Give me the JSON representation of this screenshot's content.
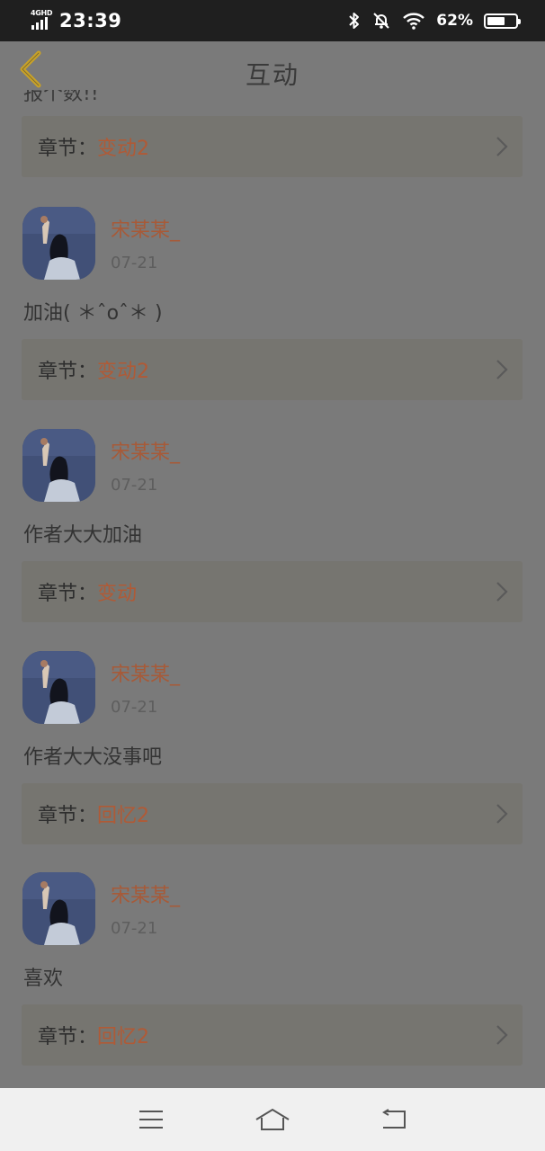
{
  "status_bar": {
    "network": "4GHD",
    "time": "23:39",
    "battery_percent": "62%",
    "battery_level": 0.62,
    "icons": [
      "bluetooth-icon",
      "bell-muted-icon",
      "wifi-icon",
      "battery-icon"
    ]
  },
  "header": {
    "title": "互动",
    "back_icon": "chevron-left-icon",
    "back_color": "#c9a227"
  },
  "partial_text": "报个数!!",
  "first_chapter": {
    "label": "章节：",
    "name": "变动2"
  },
  "comments": [
    {
      "user": "宋某某_",
      "date": "07-21",
      "text": "加油( ＊ˆoˆ＊ )",
      "chapter_label": "章节：",
      "chapter_name": "变动2"
    },
    {
      "user": "宋某某_",
      "date": "07-21",
      "text": "作者大大加油",
      "chapter_label": "章节：",
      "chapter_name": "变动"
    },
    {
      "user": "宋某某_",
      "date": "07-21",
      "text": "作者大大没事吧",
      "chapter_label": "章节：",
      "chapter_name": "回忆2"
    },
    {
      "user": "宋某某_",
      "date": "07-21",
      "text": "喜欢",
      "chapter_label": "章节：",
      "chapter_name": "回忆2"
    }
  ],
  "nav_bar": {
    "icons": [
      "menu-icon",
      "home-icon",
      "back-icon"
    ]
  },
  "colors": {
    "accent_name": "#a75a38",
    "chapter_name": "#b05a36",
    "overlay_bg": "#7a7a7a"
  }
}
